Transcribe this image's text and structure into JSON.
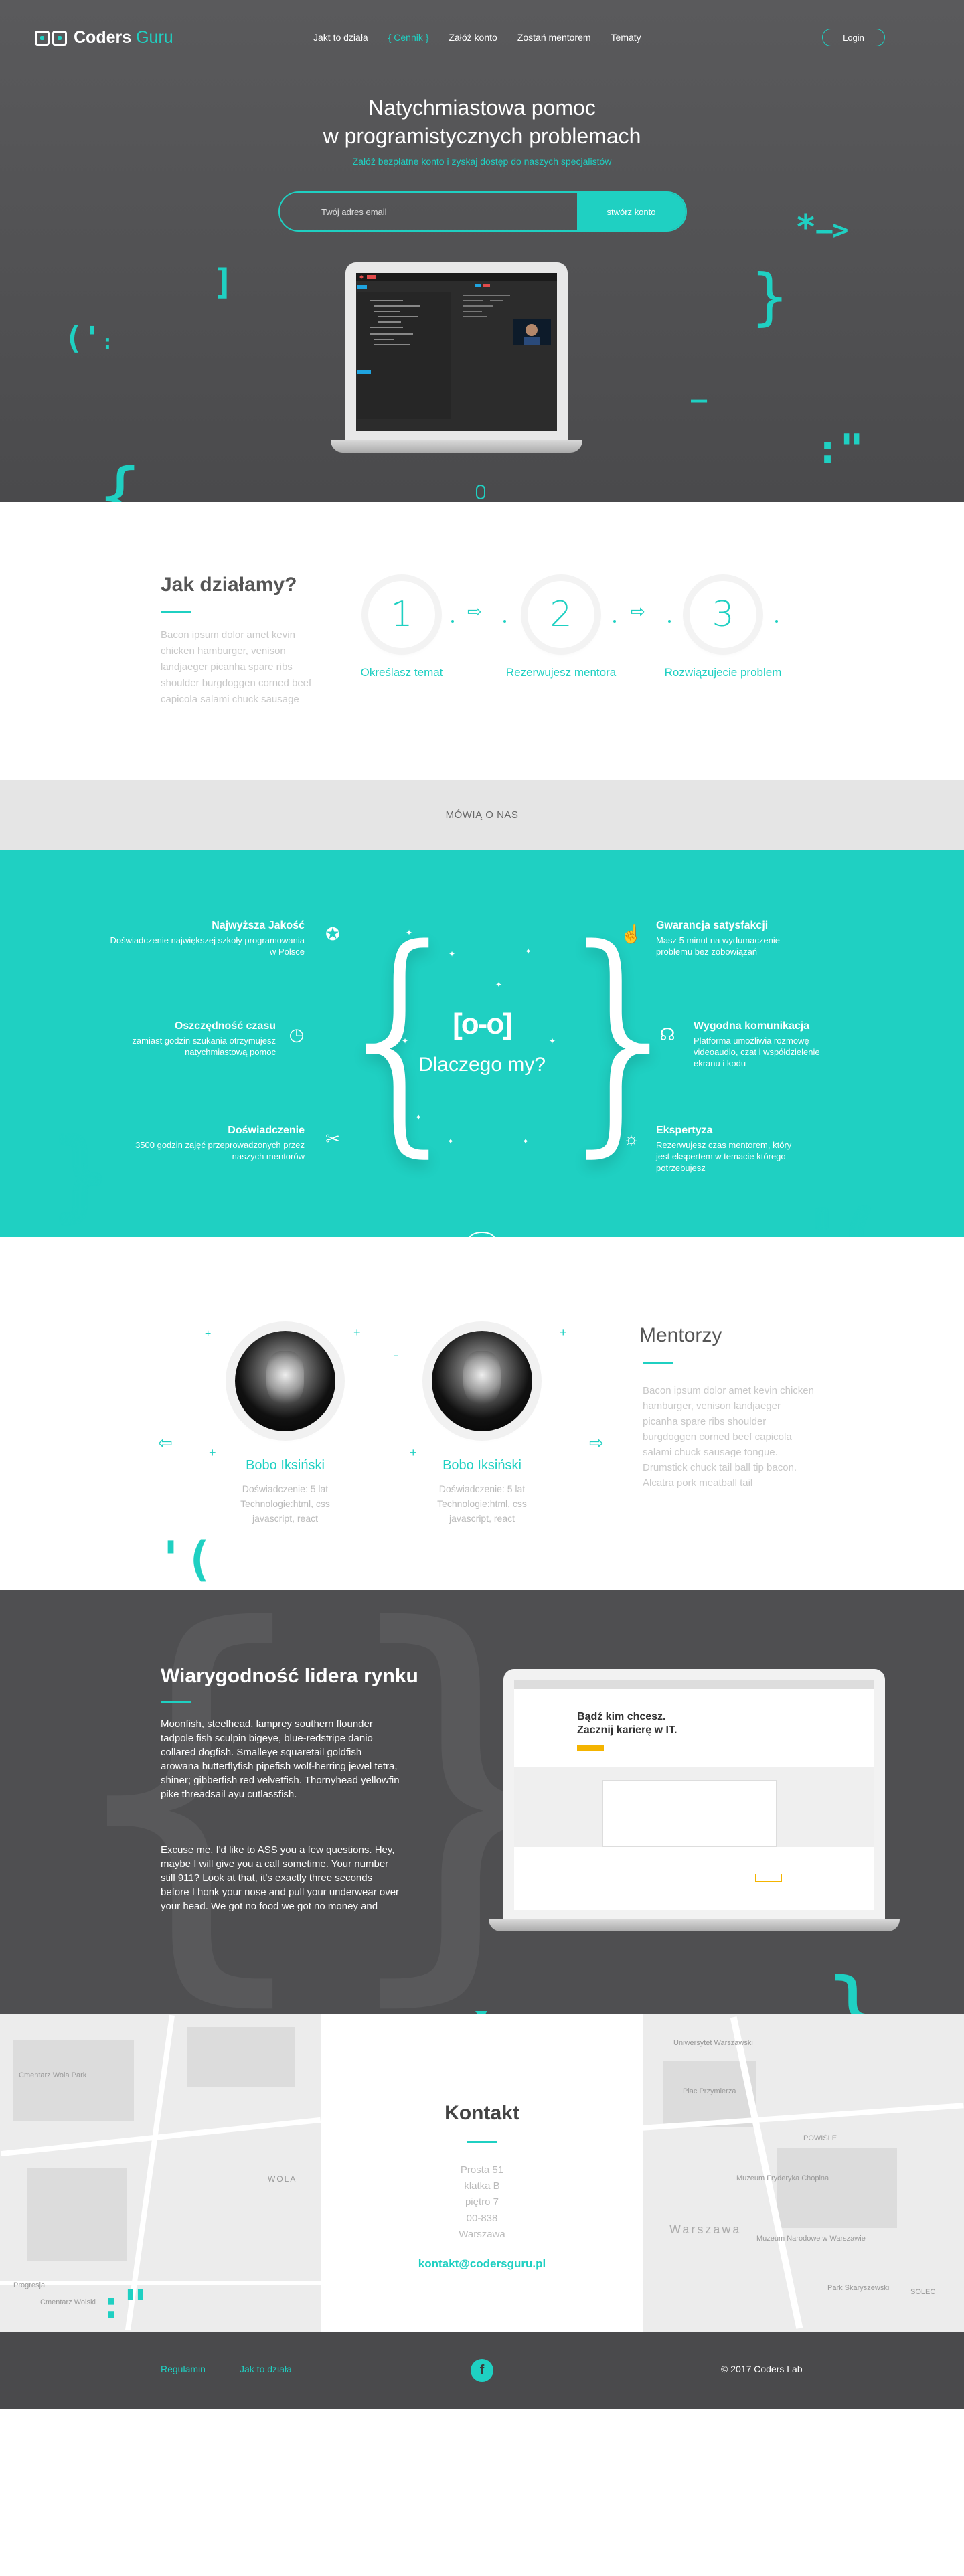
{
  "brand": {
    "name_a": "Coders",
    "name_b": "Guru"
  },
  "nav": {
    "items": [
      "Jakt to działa",
      "{ Cennik }",
      "Załóż konto",
      "Zostań mentorem",
      "Tematy"
    ],
    "login": "Login"
  },
  "hero": {
    "title_1": "Natychmiastowa pomoc",
    "title_2": "w programistycznych problemach",
    "subtitle": "Załóż bezpłatne konto i zyskaj dostęp do naszych specjalistów",
    "email_placeholder": "Twój adres email",
    "cta": "stwórz konto"
  },
  "how": {
    "title": "Jak działamy?",
    "desc": "Bacon ipsum dolor amet kevin chicken hamburger, venison landjaeger picanha spare ribs shoulder burgdoggen corned beef capicola salami chuck sausage",
    "steps": [
      {
        "num": "1",
        "label": "Określasz temat"
      },
      {
        "num": "2",
        "label": "Rezerwujesz mentora"
      },
      {
        "num": "3",
        "label": "Rozwiązujecie problem"
      }
    ]
  },
  "testimonials": {
    "title": "MÓWIĄ O NAS"
  },
  "why": {
    "title": "Dlaczego my?",
    "left": [
      {
        "title": "Najwyższa Jakość",
        "desc": "Doświadczenie największej szkoły programowania w Polsce",
        "icon": "medal-icon"
      },
      {
        "title": "Oszczędność czasu",
        "desc": "zamiast godzin szukania otrzymujesz natychmiastową pomoc",
        "icon": "stopwatch-icon"
      },
      {
        "title": "Doświadczenie",
        "desc": "3500 godzin zajęć przeprowadzonych przez naszych mentorów",
        "icon": "tools-icon"
      }
    ],
    "right": [
      {
        "title": "Gwarancja satysfakcji",
        "desc": "Masz 5 minut na wydumaczenie problemu bez zobowiązań",
        "icon": "thumbs-up-icon"
      },
      {
        "title": "Wygodna komunikacja",
        "desc": "Platforma umożliwia rozmowę videoaudio, czat i współdzielenie ekranu i kodu",
        "icon": "headset-icon"
      },
      {
        "title": "Ekspertyza",
        "desc": "Rezerwujesz czas mentorem, który jest ekspertem w temacie którego potrzebujesz",
        "icon": "lightbulb-icon"
      }
    ]
  },
  "mentors": {
    "title": "Mentorzy",
    "desc": "Bacon ipsum dolor amet kevin chicken hamburger, venison landjaeger picanha spare ribs shoulder burgdoggen corned beef capicola salami chuck sausage tongue. Drumstick chuck tail ball tip bacon. Alcatra pork meatball tail",
    "items": [
      {
        "name": "Bobo Iksiński",
        "exp": "Doświadczenie: 5 lat",
        "tech": "Technologie:html, css",
        "tech2": "javascript, react"
      },
      {
        "name": "Bobo Iksiński",
        "exp": "Doświadczenie: 5 lat",
        "tech": "Technologie:html, css",
        "tech2": "javascript, react"
      }
    ]
  },
  "trust": {
    "title": "Wiarygodność lidera rynku",
    "p1": "Moonfish, steelhead, lamprey southern flounder tadpole fish sculpin bigeye, blue-redstripe danio collared dogfish. Smalleye squaretail goldfish arowana butterflyfish pipefish wolf-herring jewel tetra, shiner; gibberfish red velvetfish. Thornyhead yellowfin pike threadsail ayu cutlassfish.",
    "p2": "Excuse me, I'd like to ASS you a few questions. Hey, maybe I will give you a call sometime. Your number still 911? Look at that, it's exactly three seconds before I honk your nose and pull your underwear over your head. We got no food we got no money and",
    "screen_headline_1": "Bądź kim chcesz.",
    "screen_headline_2": "Zacznij karierę w IT."
  },
  "contact": {
    "title": "Kontakt",
    "street": "Prosta 51",
    "building": "klatka B",
    "floor": "piętro 7",
    "zip": "00-838",
    "city": "Warszawa",
    "email": "kontakt@codersguru.pl",
    "map_labels": [
      "Cmentarz Wola Park",
      "Cmentarz Wolski",
      "Progresja",
      "WOLA",
      "Plac Przymierza",
      "Warszawa",
      "Uniwersytet Warszawski",
      "Muzeum Narodowe w Warszawie",
      "Muzeum Fryderyka Chopina",
      "POWIŚLE",
      "Park Skaryszewski",
      "SOLEC"
    ]
  },
  "footer": {
    "link_1": "Regulamin",
    "link_2": "Jak to działa",
    "facebook": "f",
    "copyright": "© 2017 Coders Lab"
  }
}
